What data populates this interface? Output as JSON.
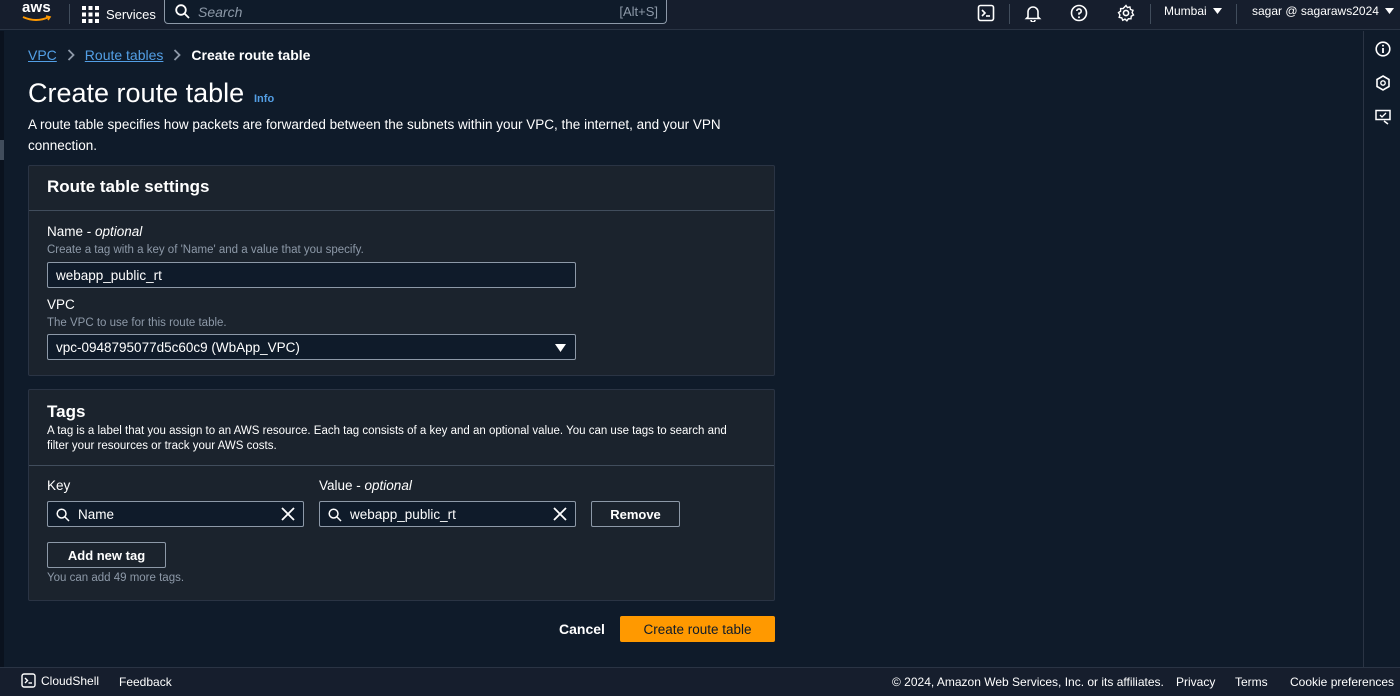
{
  "topnav": {
    "logo": "aws",
    "services_label": "Services",
    "search_placeholder": "Search",
    "search_shortcut": "[Alt+S]",
    "region": "Mumbai",
    "user": "sagar @ sagaraws2024",
    "icons": [
      "cloudshell-icon",
      "notifications-icon",
      "help-icon",
      "settings-icon"
    ]
  },
  "breadcrumb": {
    "items": [
      "VPC",
      "Route tables"
    ],
    "current": "Create route table"
  },
  "page": {
    "title": "Create route table",
    "info": "Info",
    "description": "A route table specifies how packets are forwarded between the subnets within your VPC, the internet, and your VPN connection."
  },
  "settings": {
    "heading": "Route table settings",
    "name_label": "Name - ",
    "name_label_optional": "optional",
    "name_help": "Create a tag with a key of 'Name' and a value that you specify.",
    "name_value": "webapp_public_rt",
    "vpc_label": "VPC",
    "vpc_help": "The VPC to use for this route table.",
    "vpc_value": "vpc-0948795077d5c60c9 (WbApp_VPC)"
  },
  "tags": {
    "heading": "Tags",
    "description": "A tag is a label that you assign to an AWS resource. Each tag consists of a key and an optional value. You can use tags to search and filter your resources or track your AWS costs.",
    "key_label": "Key",
    "value_label": "Value - ",
    "value_label_optional": "optional",
    "key_value": "Name",
    "value_value": "webapp_public_rt",
    "remove_label": "Remove",
    "add_label": "Add new tag",
    "remaining": "You can add 49 more tags."
  },
  "actions": {
    "cancel": "Cancel",
    "submit": "Create route table"
  },
  "footer": {
    "cloudshell": "CloudShell",
    "feedback": "Feedback",
    "copyright": "© 2024, Amazon Web Services, Inc. or its affiliates.",
    "privacy": "Privacy",
    "terms": "Terms",
    "cookies": "Cookie preferences"
  },
  "colors": {
    "background": "#0f1b2a",
    "panel": "#1b232d",
    "link": "#539fe5",
    "primary": "#ff9900"
  }
}
